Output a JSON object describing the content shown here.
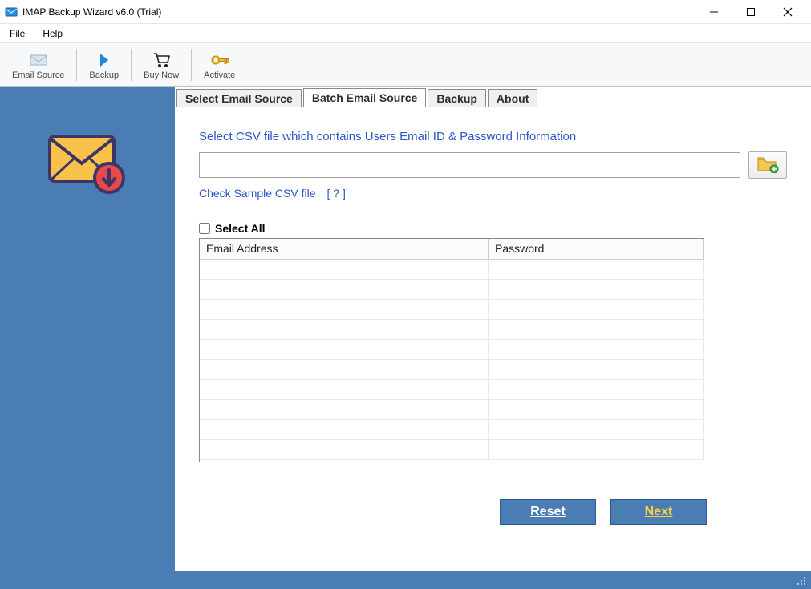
{
  "title": "IMAP Backup Wizard v6.0 (Trial)",
  "menu": {
    "file": "File",
    "help": "Help"
  },
  "toolbar": {
    "email_source": "Email Source",
    "backup": "Backup",
    "buy_now": "Buy Now",
    "activate": "Activate"
  },
  "tabs": {
    "select_source": "Select Email Source",
    "batch_source": "Batch Email Source",
    "backup": "Backup",
    "about": "About"
  },
  "panel": {
    "instruction": "Select CSV file which contains Users Email ID & Password Information",
    "file_value": "",
    "sample_link": "Check Sample CSV file",
    "sample_help": "[ ? ]",
    "select_all": "Select All"
  },
  "grid": {
    "columns": [
      "Email Address",
      "Password"
    ],
    "rows": []
  },
  "actions": {
    "reset": "Reset",
    "next": "Next"
  }
}
